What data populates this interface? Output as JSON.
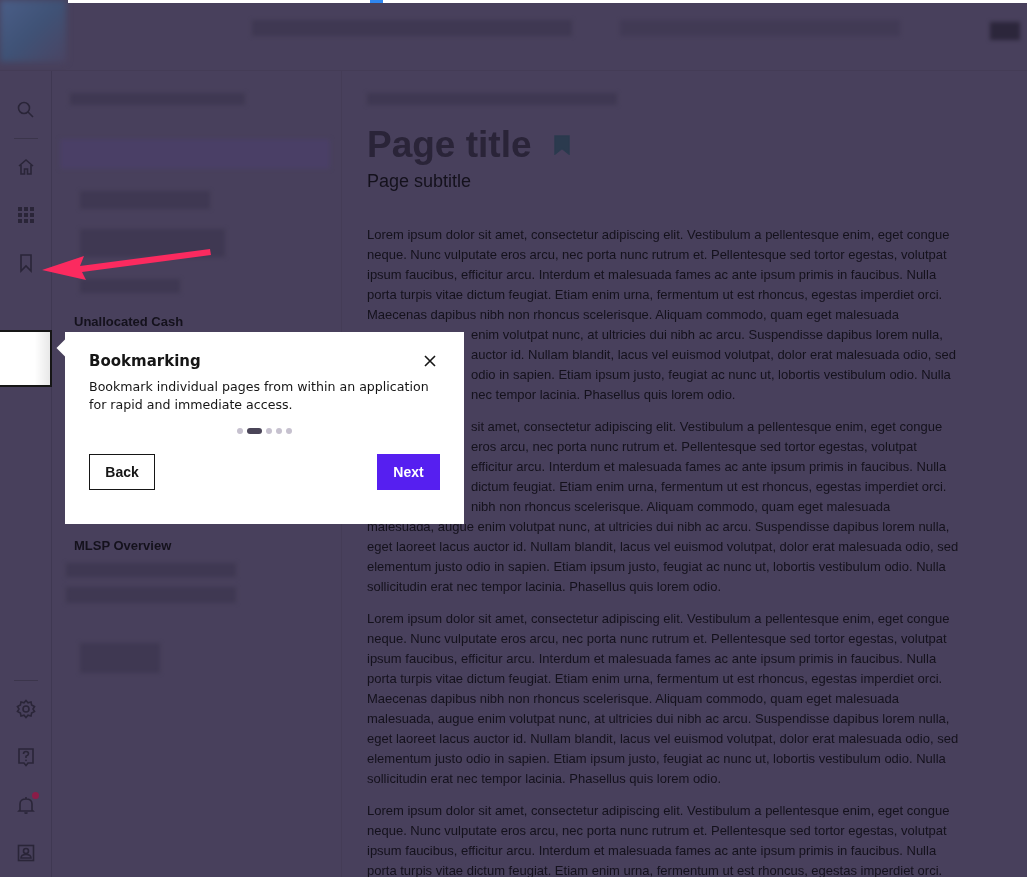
{
  "rail": {
    "top_items": [
      {
        "kind": "search"
      },
      {
        "kind": "divider"
      },
      {
        "kind": "home"
      },
      {
        "kind": "apps"
      },
      {
        "kind": "bookmark"
      }
    ],
    "bottom_items": [
      {
        "kind": "settings"
      },
      {
        "kind": "help"
      },
      {
        "kind": "bell",
        "badge": true
      },
      {
        "kind": "account"
      }
    ]
  },
  "sidebar": {
    "items": [
      {
        "label": "Unallocated Cash"
      },
      {
        "label": "MLSP Overview"
      }
    ]
  },
  "page": {
    "title": "Page title",
    "bookmarked": true,
    "subtitle": "Page subtitle",
    "paragraphs": [
      {
        "lines": [
          "Lorem ipsum dolor sit amet, consectetur adipiscing elit. Vestibulum a pellentesque enim, eget congue",
          "neque. Nunc vulputate eros arcu, nec porta nunc rutrum et. Pellentesque sed tortor egestas, volutpat",
          "ipsum faucibus, efficitur arcu. Interdum et malesuada fames ac ante ipsum primis in faucibus. Nulla",
          "porta turpis vitae dictum feugiat. Etiam enim urna, fermentum ut est rhoncus, egestas imperdiet orci.",
          "Maecenas dapibus nibh non rhoncus scelerisque. Aliquam commodo, quam eget malesuada",
          "enim volutpat nunc, at ultricies dui nibh ac arcu. Suspendisse dapibus lorem nulla,",
          "auctor id. Nullam blandit, lacus vel euismod volutpat, dolor erat malesuada odio, sed",
          "odio in sapien. Etiam ipsum justo, feugiat ac nunc ut, lobortis vestibulum odio. Nulla",
          "nec tempor lacinia. Phasellus quis lorem odio."
        ]
      },
      {
        "lines": [
          "sit amet, consectetur adipiscing elit. Vestibulum a pellentesque enim, eget congue",
          "eros arcu, nec porta nunc rutrum et. Pellentesque sed tortor egestas, volutpat",
          "efficitur arcu. Interdum et malesuada fames ac ante ipsum primis in faucibus. Nulla",
          "dictum feugiat. Etiam enim urna, fermentum ut est rhoncus, egestas imperdiet orci.",
          "nibh non rhoncus scelerisque. Aliquam commodo, quam eget malesuada",
          "malesuada, augue enim volutpat nunc, at ultricies dui nibh ac arcu. Suspendisse dapibus lorem nulla,",
          "eget laoreet lacus auctor id. Nullam blandit, lacus vel euismod volutpat, dolor erat malesuada odio, sed",
          "elementum justo odio in sapien. Etiam ipsum justo, feugiat ac nunc ut, lobortis vestibulum odio. Nulla",
          "sollicitudin erat nec tempor lacinia. Phasellus quis lorem odio."
        ]
      },
      {
        "lines": [
          "Lorem ipsum dolor sit amet, consectetur adipiscing elit. Vestibulum a pellentesque enim, eget congue",
          "neque. Nunc vulputate eros arcu, nec porta nunc rutrum et. Pellentesque sed tortor egestas, volutpat",
          "ipsum faucibus, efficitur arcu. Interdum et malesuada fames ac ante ipsum primis in faucibus. Nulla",
          "porta turpis vitae dictum feugiat. Etiam enim urna, fermentum ut est rhoncus, egestas imperdiet orci.",
          "Maecenas dapibus nibh non rhoncus scelerisque. Aliquam commodo, quam eget malesuada",
          "malesuada, augue enim volutpat nunc, at ultricies dui nibh ac arcu. Suspendisse dapibus lorem nulla,",
          "eget laoreet lacus auctor id. Nullam blandit, lacus vel euismod volutpat, dolor erat malesuada odio, sed",
          "elementum justo odio in sapien. Etiam ipsum justo, feugiat ac nunc ut, lobortis vestibulum odio. Nulla",
          "sollicitudin erat nec tempor lacinia. Phasellus quis lorem odio."
        ]
      },
      {
        "lines": [
          "Lorem ipsum dolor sit amet, consectetur adipiscing elit. Vestibulum a pellentesque enim, eget congue",
          "neque. Nunc vulputate eros arcu, nec porta nunc rutrum et. Pellentesque sed tortor egestas, volutpat",
          "ipsum faucibus, efficitur arcu. Interdum et malesuada fames ac ante ipsum primis in faucibus. Nulla",
          "porta turpis vitae dictum feugiat. Etiam enim urna, fermentum ut est rhoncus, egestas imperdiet orci."
        ]
      }
    ]
  },
  "tour": {
    "title": "Bookmarking",
    "body": "Bookmark individual pages from within an application for rapid and immediate access.",
    "steps": [
      {
        "selected": false
      },
      {
        "selected": true
      },
      {
        "selected": false
      },
      {
        "selected": false
      },
      {
        "selected": false
      }
    ],
    "buttons": [
      {
        "label": "Back",
        "kind": "secondary"
      },
      {
        "label": "Next",
        "kind": "primary"
      }
    ]
  }
}
